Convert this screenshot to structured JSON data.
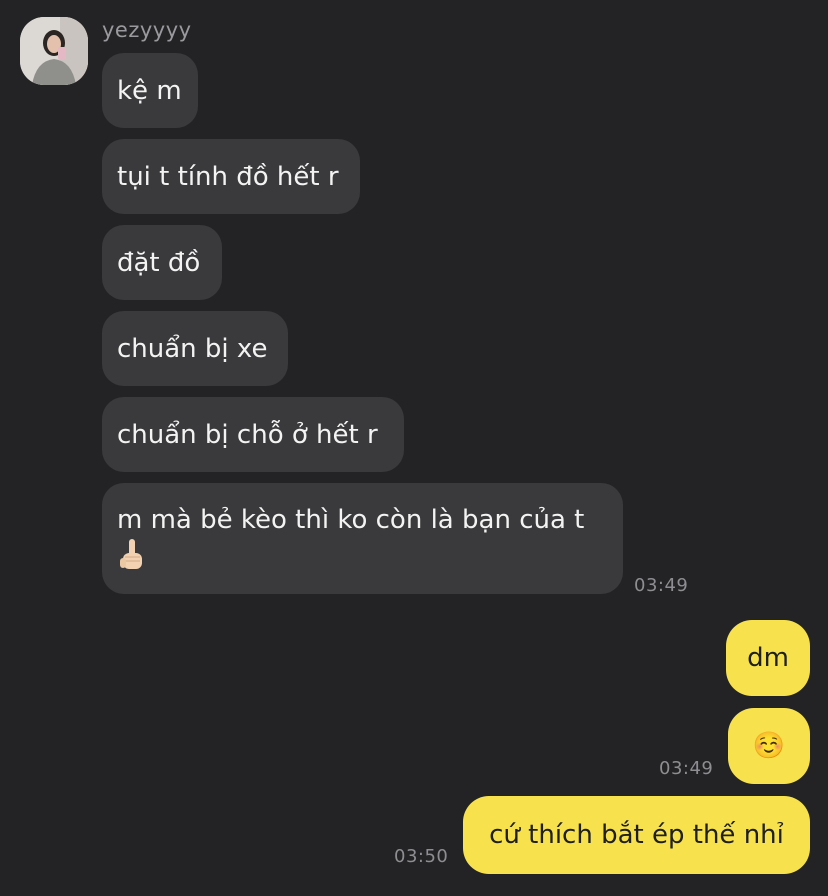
{
  "chat": {
    "sender": {
      "name": "yezyyyy",
      "avatar_icon": "profile-photo"
    },
    "incoming": [
      {
        "text": "kệ m"
      },
      {
        "text": "tụi t tính đồ hết r"
      },
      {
        "text": "đặt đồ"
      },
      {
        "text": "chuẩn bị xe"
      },
      {
        "text": "chuẩn bị chỗ ở hết r"
      },
      {
        "text": "m mà bẻ kèo thì ko còn là bạn của t",
        "emoji_icon": "middle-finger-emoji",
        "time": "03:49"
      }
    ],
    "outgoing": [
      {
        "text": "dm"
      },
      {
        "text": "☺️",
        "time": "03:49"
      },
      {
        "text": "cứ thích bắt ép thế nhỉ",
        "time": "03:50"
      }
    ]
  },
  "colors": {
    "background": "#232325",
    "incoming_bubble": "#3a3a3c",
    "outgoing_bubble": "#f7e24d",
    "timestamp": "#8e8e92"
  }
}
